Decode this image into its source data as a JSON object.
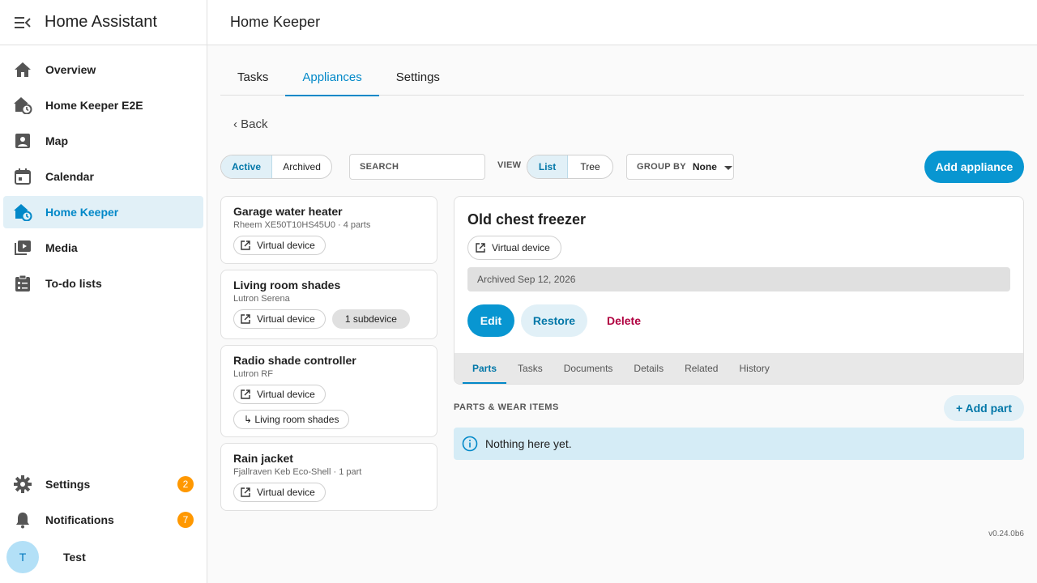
{
  "sidebar": {
    "title": "Home Assistant",
    "items": [
      {
        "label": "Overview",
        "icon": "home-icon"
      },
      {
        "label": "Home Keeper E2E",
        "icon": "home-clock-icon"
      },
      {
        "label": "Map",
        "icon": "map-icon"
      },
      {
        "label": "Calendar",
        "icon": "calendar-icon"
      },
      {
        "label": "Home Keeper",
        "icon": "home-clock-icon",
        "active": true
      },
      {
        "label": "Media",
        "icon": "media-icon"
      },
      {
        "label": "To-do lists",
        "icon": "clipboard-list-icon"
      }
    ],
    "settings": {
      "label": "Settings",
      "badge": "2"
    },
    "notifications": {
      "label": "Notifications",
      "badge": "7"
    },
    "user": {
      "initial": "T",
      "name": "Test"
    }
  },
  "topbar": {
    "title": "Home Keeper"
  },
  "tabs": [
    {
      "label": "Tasks"
    },
    {
      "label": "Appliances",
      "active": true
    },
    {
      "label": "Settings"
    }
  ],
  "back_label": "‹ Back",
  "filter": {
    "active": "Active",
    "archived": "Archived"
  },
  "search": {
    "placeholder": "SEARCH"
  },
  "view": {
    "label": "VIEW",
    "list": "List",
    "tree": "Tree"
  },
  "group_by": {
    "label": "GROUP BY",
    "value": "None"
  },
  "add_appliance": "Add appliance",
  "appliances": [
    {
      "name": "Garage water heater",
      "sub": "Rheem XE50T10HS45U0 · 4 parts",
      "chip": "Virtual device"
    },
    {
      "name": "Living room shades",
      "sub": "Lutron Serena",
      "chip": "Virtual device",
      "extra": "1 subdevice"
    },
    {
      "name": "Radio shade controller",
      "sub": "Lutron RF",
      "chip": "Virtual device",
      "parent": "↳ Living room shades"
    },
    {
      "name": "Rain jacket",
      "sub": "Fjallraven Keb Eco-Shell · 1 part",
      "chip": "Virtual device"
    }
  ],
  "detail": {
    "title": "Old chest freezer",
    "chip": "Virtual device",
    "archived": "Archived Sep 12, 2026",
    "edit": "Edit",
    "restore": "Restore",
    "delete": "Delete",
    "tabs": [
      "Parts",
      "Tasks",
      "Documents",
      "Details",
      "Related",
      "History"
    ]
  },
  "parts": {
    "header": "PARTS & WEAR ITEMS",
    "add": "+ Add part",
    "empty": "Nothing here yet."
  },
  "version": "v0.24.0b6",
  "colors": {
    "accent": "#0896d1",
    "badge": "#ff9800",
    "delete": "#b00040"
  }
}
